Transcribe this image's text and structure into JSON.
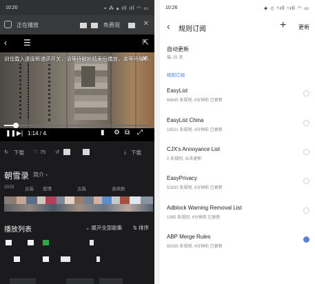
{
  "left": {
    "status_bar": {
      "time": "10:20",
      "icons": "▪ ⁂ ▴ ıll ıll ◠ ▭"
    },
    "banner": {
      "text": "正在播放",
      "right_text": "免费观"
    },
    "player": {
      "subtitle": "训伐载入速度断通道开关，请等待解析结束后播放，诶等待解析，请等待 秒钟。",
      "time": "1:14 / 4.",
      "progress": 0.08
    },
    "actions": {
      "download": "下载",
      "likes": "75",
      "download2": "下载"
    },
    "show": {
      "title": "朝雪录",
      "intro": "简介",
      "meta": [
        "2025",
        "古装",
        "爱情",
        "古装",
        "连续剧"
      ]
    },
    "playlist": {
      "heading": "播放列表",
      "expand": "展开全部剧集",
      "sort": "排序"
    },
    "colors": {
      "bg": "#1b1b1d",
      "accent": "#2aa84a"
    }
  },
  "right": {
    "status_bar": {
      "time": "10:26",
      "icons": "◈ ◇ ⁵ıll ⁵ıll ◠ ▭"
    },
    "header": {
      "title": "规则订阅",
      "add_icon": "+",
      "update": "更新"
    },
    "auto_update": {
      "label": "自动更新",
      "interval": "每 15 天"
    },
    "section_label": "规则订阅",
    "rules": [
      {
        "name": "EasyList",
        "desc": "66845 条规则, 4分钟前 已更新",
        "enabled": false
      },
      {
        "name": "EasyList China",
        "desc": "16521 条规则, 4分钟前 已更新",
        "enabled": false
      },
      {
        "name": "CJX's Annoyance List",
        "desc": "0 条规则, 从未更新",
        "enabled": false
      },
      {
        "name": "EasyPrivacy",
        "desc": "52830 条规则, 4分钟前 已更新",
        "enabled": false
      },
      {
        "name": "Adblock Warning Removal List",
        "desc": "1985 条规则, 4分钟前 已更新",
        "enabled": false
      },
      {
        "name": "ABP Merge Rules",
        "desc": "85038 条规则, 4分钟前 已更新",
        "enabled": true
      }
    ],
    "colors": {
      "accent": "#5b7fd6",
      "section": "#4a78d4"
    }
  }
}
